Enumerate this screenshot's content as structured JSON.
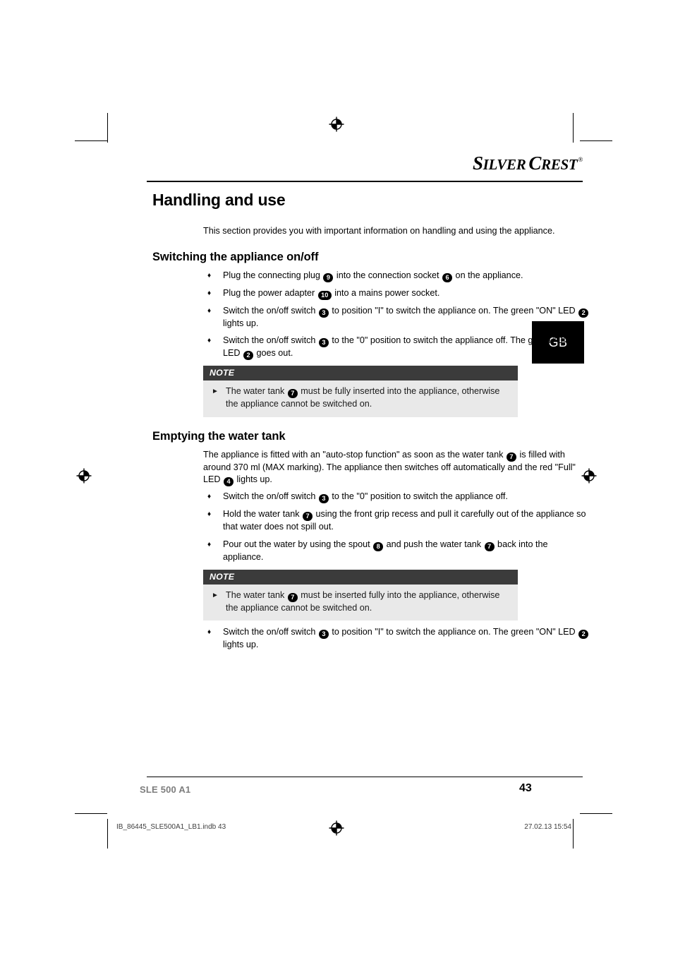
{
  "brand": {
    "name_part1": "S",
    "name_part2": "ILVER",
    "name_part3": "C",
    "name_part4": "REST",
    "registered_mark": "®"
  },
  "language_tab": {
    "label": "GB"
  },
  "page": {
    "title": "Handling and use",
    "intro": "This section provides you with important information on handling and using the appliance."
  },
  "sections": [
    {
      "heading": "Switching the appliance on/off",
      "bullets": [
        {
          "parts": [
            {
              "type": "text",
              "value": "Plug the connecting plug "
            },
            {
              "type": "badge",
              "value": "9"
            },
            {
              "type": "text",
              "value": " into the connection socket "
            },
            {
              "type": "badge",
              "value": "6"
            },
            {
              "type": "text",
              "value": " on the appliance."
            }
          ]
        },
        {
          "parts": [
            {
              "type": "text",
              "value": "Plug the power adapter "
            },
            {
              "type": "badge",
              "value": "10"
            },
            {
              "type": "text",
              "value": " into a mains power socket."
            }
          ]
        },
        {
          "parts": [
            {
              "type": "text",
              "value": "Switch the on/off switch "
            },
            {
              "type": "badge",
              "value": "3"
            },
            {
              "type": "text",
              "value": " to position \"I\" to switch the appliance on. The green \"ON\" LED "
            },
            {
              "type": "badge",
              "value": "2"
            },
            {
              "type": "text",
              "value": " lights up."
            }
          ]
        },
        {
          "parts": [
            {
              "type": "text",
              "value": "Switch the on/off switch "
            },
            {
              "type": "badge",
              "value": "3"
            },
            {
              "type": "text",
              "value": " to the \"0\" position to switch the appliance off. The green \"ON\" LED "
            },
            {
              "type": "badge",
              "value": "2"
            },
            {
              "type": "text",
              "value": " goes out."
            }
          ]
        }
      ],
      "note": {
        "heading": "NOTE",
        "items": [
          {
            "parts": [
              {
                "type": "text",
                "value": "The water tank "
              },
              {
                "type": "badge",
                "value": "7"
              },
              {
                "type": "text",
                "value": " must be fully inserted into the appliance, otherwise the appliance cannot be switched on."
              }
            ]
          }
        ]
      }
    },
    {
      "heading": "Emptying the water tank",
      "intro_parts": [
        {
          "type": "text",
          "value": "The appliance is fitted with an \"auto-stop function\" as soon as the water tank "
        },
        {
          "type": "badge",
          "value": "7"
        },
        {
          "type": "text",
          "value": " is filled with around 370 ml (MAX marking). The appliance then switches off automatically and the red \"Full\" LED "
        },
        {
          "type": "badge",
          "value": "4"
        },
        {
          "type": "text",
          "value": " lights up."
        }
      ],
      "bullets": [
        {
          "parts": [
            {
              "type": "text",
              "value": "Switch the on/off switch "
            },
            {
              "type": "badge",
              "value": "3"
            },
            {
              "type": "text",
              "value": " to the \"0\" position to switch the appliance off."
            }
          ]
        },
        {
          "parts": [
            {
              "type": "text",
              "value": "Hold the water tank "
            },
            {
              "type": "badge",
              "value": "7"
            },
            {
              "type": "text",
              "value": " using the front grip recess and pull it carefully out of the appliance so that water does not spill out."
            }
          ]
        },
        {
          "parts": [
            {
              "type": "text",
              "value": "Pour out the water by using the spout "
            },
            {
              "type": "badge",
              "value": "8"
            },
            {
              "type": "text",
              "value": " and push the water tank "
            },
            {
              "type": "badge",
              "value": "7"
            },
            {
              "type": "text",
              "value": " back into the appliance."
            }
          ]
        }
      ],
      "note": {
        "heading": "NOTE",
        "items": [
          {
            "parts": [
              {
                "type": "text",
                "value": "The water tank "
              },
              {
                "type": "badge",
                "value": "7"
              },
              {
                "type": "text",
                "value": " must be inserted fully into the appliance, otherwise the appliance cannot be switched on."
              }
            ]
          }
        ]
      },
      "trailing_bullets": [
        {
          "parts": [
            {
              "type": "text",
              "value": "Switch the on/off switch "
            },
            {
              "type": "badge",
              "value": "3"
            },
            {
              "type": "text",
              "value": " to position \"I\" to switch the appliance on. The green \"ON\" LED "
            },
            {
              "type": "badge",
              "value": "2"
            },
            {
              "type": "text",
              "value": " lights up."
            }
          ]
        }
      ]
    }
  ],
  "footer": {
    "model": "SLE 500 A1",
    "page_number": "43",
    "print_file": "IB_86445_SLE500A1_LB1.indb   43",
    "print_date": "27.02.13   15:54"
  },
  "glyphs": {
    "bullet_diamond": "♦",
    "note_arrow": "►"
  }
}
